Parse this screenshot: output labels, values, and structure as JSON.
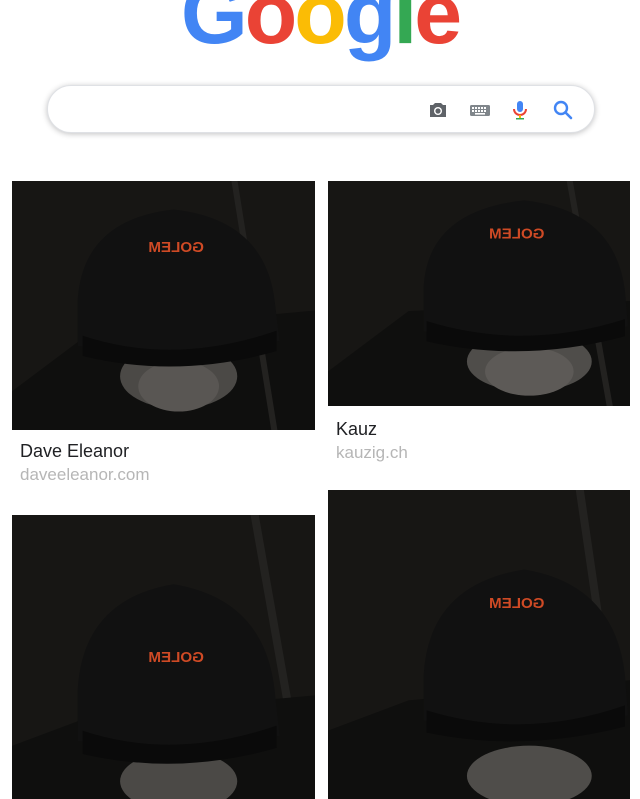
{
  "logo": {
    "letters": [
      "G",
      "o",
      "o",
      "g",
      "l",
      "e"
    ],
    "colors": [
      "#4285F4",
      "#EA4335",
      "#FBBC05",
      "#4285F4",
      "#34A853",
      "#EA4335"
    ]
  },
  "search": {
    "value": "",
    "placeholder": "",
    "icons": [
      "camera-icon",
      "keyboard-icon",
      "microphone-icon",
      "search-icon"
    ]
  },
  "results": [
    {
      "title": "Dave Eleanor",
      "source": "daveeleanor.com",
      "cap_text": "GOLEM"
    },
    {
      "title": "Kauz",
      "source": "kauzig.ch",
      "cap_text": "GOLEM"
    },
    {
      "title": "",
      "source": "",
      "cap_text": "GOLEM"
    },
    {
      "title": "",
      "source": "",
      "cap_text": "GOLEM"
    }
  ]
}
